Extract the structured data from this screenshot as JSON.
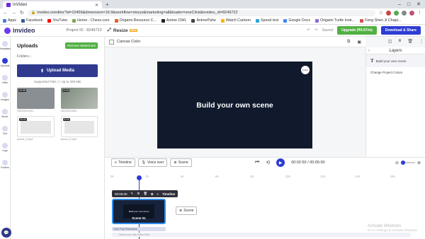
{
  "browser": {
    "tab_title": "InVideo",
    "url": "invideo.io/editor?id=10456&dimension=16:9&workflow=storyα&marketing=all&loader=oneClick&invideo_id=8249722",
    "bookmarks": [
      {
        "label": "Apps",
        "color": "#4a7de2"
      },
      {
        "label": "Facebook",
        "color": "#3b5998"
      },
      {
        "label": "YouTube",
        "color": "#ff0000"
      },
      {
        "label": "Home - Chess.com",
        "color": "#7fa650"
      },
      {
        "label": "Origami Resource C...",
        "color": "#e65f2a"
      },
      {
        "label": "Anime OWL",
        "color": "#222222"
      },
      {
        "label": "AnimePahe",
        "color": "#444444"
      },
      {
        "label": "Watch Cartoon",
        "color": "#ffb400"
      },
      {
        "label": "Speed test",
        "color": "#2aa4d5"
      },
      {
        "label": "Google Docs",
        "color": "#4285f4"
      },
      {
        "label": "Origami Turtle Instr...",
        "color": "#8c6bd8"
      },
      {
        "label": "Feng Shen Ji Chapt...",
        "color": "#d24f4f"
      }
    ]
  },
  "topbar": {
    "logo_text": "invideo",
    "project_id": "Project ID : 8249722",
    "resize_label": "Resize",
    "resize_badge": "NEW",
    "saved_label": "Saved",
    "upgrade_label": "Upgrade (₹0.07/m)",
    "download_label": "Download & Share"
  },
  "leftnav": [
    {
      "label": "Templates",
      "active": false
    },
    {
      "label": "Uploads",
      "active": true
    },
    {
      "label": "Video",
      "active": false
    },
    {
      "label": "Images",
      "active": false
    },
    {
      "label": "Music",
      "active": false
    },
    {
      "label": "Text",
      "active": false
    },
    {
      "label": "Logo",
      "active": false
    },
    {
      "label": "Folders",
      "active": false
    }
  ],
  "panel": {
    "title": "Uploads",
    "remove_watermark": "Remove Watermark",
    "folders": "Folders  ›",
    "upload_button": "Upload Media",
    "supported": "Supported Files  ⓘ  Up to 200 MB",
    "thumbs": [
      {
        "duration": "00:08",
        "name": "VID20201020..."
      },
      {
        "duration": "00:08",
        "name": "VID20210202..."
      },
      {
        "duration": "00:00",
        "name": "sound_2.mp4"
      },
      {
        "duration": "00:00",
        "name": "sound_3.mp4"
      }
    ]
  },
  "canvas": {
    "label": "Canvas Color",
    "video_title": "Build your own scene",
    "watermark": "invideo"
  },
  "layers": {
    "title": "Layers",
    "items": [
      "Build your own scene",
      "Change Project Colors"
    ]
  },
  "timeline_bar": {
    "timeline_label": "Timeline",
    "voice_label": "Voice over",
    "scene_label": "Scene",
    "current_time": "00:02:50",
    "total_time": "00:05:00",
    "time_sep": "/"
  },
  "timeline": {
    "ruler": [
      "0s",
      "2s",
      "4s",
      "6s",
      "8s",
      "10s",
      "12s",
      "14s",
      "16s"
    ],
    "scene_toolbar": {
      "duration": "00:05:00",
      "timeline": "Timeline"
    },
    "scene_name": "Scene 01",
    "scene_preview": "Build your own scene",
    "add_scene": "Scene",
    "audio_track": "Indo Pop Peacetant...",
    "voice_track": "Voice-over with video here"
  },
  "os_overlay": {
    "title": "Activate Windows",
    "subtitle": "Go to Settings to activate Windows."
  },
  "colors": {
    "brand": "#2d3cd5",
    "upgrade": "#52b043",
    "video_bg": "#101a2c"
  }
}
